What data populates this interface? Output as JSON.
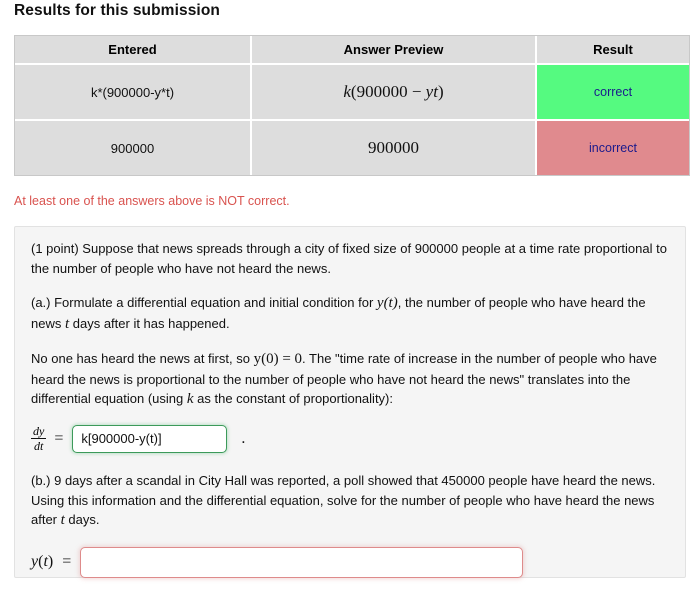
{
  "heading": "Results for this submission",
  "results_table": {
    "columns": [
      "Entered",
      "Answer Preview",
      "Result"
    ],
    "rows": [
      {
        "entered": "k*(900000-y*t)",
        "preview_prefix": "k",
        "preview_open": "(900000 − ",
        "preview_var": "yt",
        "preview_close": ")",
        "result": "correct",
        "result_state": "correct",
        "result_color": "#55fa80"
      },
      {
        "entered": "900000",
        "preview_plain": "900000",
        "result": "incorrect",
        "result_state": "incorrect",
        "result_color": "#e08a8e"
      }
    ]
  },
  "warning": {
    "text": "At least one of the answers above is NOT correct.",
    "color": "#d9534f"
  },
  "problem": {
    "intro_p1_a": "(1 point) Suppose that news spreads through a city of fixed size of 900000 people at a time rate proportional to the number of people who have not heard the news.",
    "part_a_s1": "(a.) Formulate a differential equation and initial condition for ",
    "part_a_math1": "y(t)",
    "part_a_s2": ", the number of people who have heard the news ",
    "part_a_math2": "t",
    "part_a_s3": " days after it has happened.",
    "part_a2_s1": "No one has heard the news at first, so ",
    "part_a2_math1": "y(0) = 0",
    "part_a2_s2": ". The \"time rate of increase in the number of people who have heard the news is proportional to the number of people who have not heard the news\" translates into the differential equation (using ",
    "part_a2_math2": "k",
    "part_a2_s3": " as the constant of proportionality):",
    "eq_a": {
      "frac_num": "dy",
      "frac_den": "dt",
      "equals": "=",
      "input_value": "k[900000-y(t)]",
      "input_placeholder": "",
      "input_border_color": "#3c9a5a",
      "trailing": "."
    },
    "part_b_s1": "(b.) 9 days after a scandal in City Hall was reported, a poll showed that 450000 people have heard the news. Using this information and the differential equation, solve for the number of people who have heard the news after ",
    "part_b_math1": "t",
    "part_b_s2": " days.",
    "eq_b": {
      "lhs_y": "y",
      "lhs_open": "(",
      "lhs_t": "t",
      "lhs_close": ")",
      "equals": "=",
      "input_value": "",
      "input_placeholder": "",
      "input_border_color": "#de8b8b"
    }
  }
}
